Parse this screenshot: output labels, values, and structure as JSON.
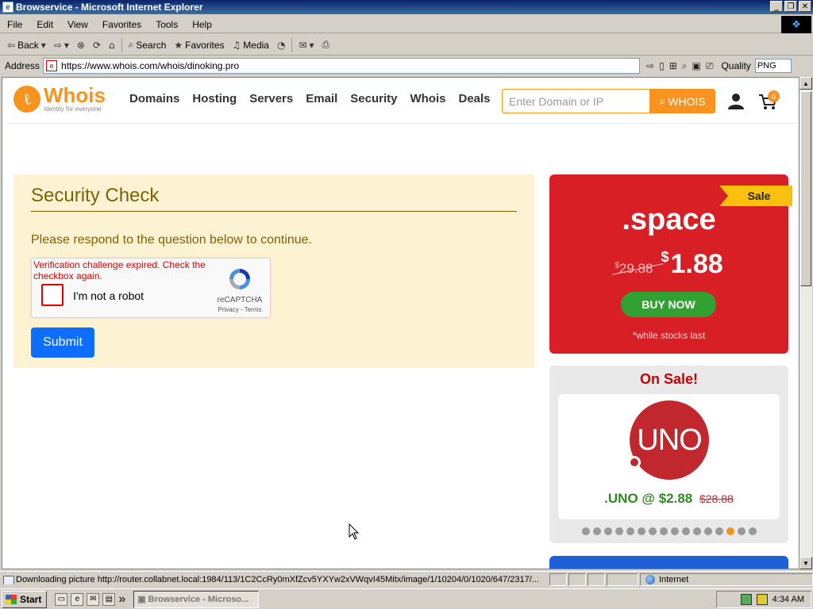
{
  "window": {
    "title": "Browservice - Microsoft Internet Explorer",
    "controls": [
      "_",
      "❐",
      "✕"
    ]
  },
  "menu": [
    "File",
    "Edit",
    "View",
    "Favorites",
    "Tools",
    "Help"
  ],
  "toolbar": {
    "back": "Back",
    "search": "Search",
    "favorites": "Favorites",
    "media": "Media"
  },
  "address": {
    "label": "Address",
    "url": "https://www.whois.com/whois/dinoking.pro",
    "quality_label": "Quality",
    "quality_value": "PNG"
  },
  "site": {
    "logo_word": "Whois",
    "logo_tagline": "Identity for everyone",
    "nav": [
      "Domains",
      "Hosting",
      "Servers",
      "Email",
      "Security",
      "Whois",
      "Deals"
    ],
    "search_placeholder": "Enter Domain or IP",
    "search_button": "WHOIS",
    "cart_count": "0"
  },
  "security_check": {
    "title": "Security Check",
    "instruction": "Please respond to the question below to continue.",
    "captcha_error": "Verification challenge expired. Check the checkbox again.",
    "captcha_label": "I'm not a robot",
    "captcha_brand": "reCAPTCHA",
    "captcha_links": "Privacy - Terms",
    "submit": "Submit"
  },
  "promo": {
    "ribbon": "Sale",
    "tld": ".space",
    "currency": "$",
    "old_price": "29.88",
    "new_price": "1.88",
    "buy": "BUY NOW",
    "note": "*while stocks last"
  },
  "on_sale": {
    "title": "On Sale!",
    "logo_text": "UNO",
    "price_text": ".UNO @ $2.88",
    "old_price": "$28.88",
    "dot_count": 16,
    "active_dot": 13
  },
  "status": {
    "text": "Downloading picture http://router.collabnet.local:1984/113/1C2CcRy0mXfZcv5YXYw2xVWqvI45Mitx/image/1/10204/0/1020/647/2317/...",
    "zone": "Internet"
  },
  "taskbar": {
    "start": "Start",
    "task": "Browservice - Microso...",
    "clock": "4:34 AM"
  },
  "colors": {
    "brand_orange": "#f7931e",
    "promo_red": "#d81f26",
    "security_panel": "#fdf2d2",
    "submit_blue": "#0d6efd",
    "buy_green": "#31a231"
  }
}
